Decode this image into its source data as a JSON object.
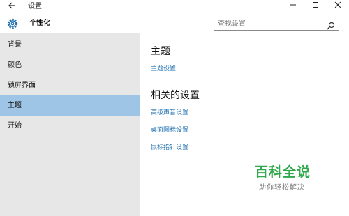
{
  "window": {
    "title": "设置",
    "back_icon": "arrow-left-icon"
  },
  "header": {
    "title": "个性化",
    "icon": "gear-icon"
  },
  "search": {
    "placeholder": "查找设置",
    "icon": "search-icon"
  },
  "sidebar": {
    "items": [
      {
        "label": "背景",
        "active": false
      },
      {
        "label": "颜色",
        "active": false
      },
      {
        "label": "锁屏界面",
        "active": false
      },
      {
        "label": "主题",
        "active": true
      },
      {
        "label": "开始",
        "active": false
      }
    ]
  },
  "main": {
    "heading": "主题",
    "theme_settings_link": "主题设置",
    "related_heading": "相关的设置",
    "related_links": [
      "高级声音设置",
      "桌面图标设置",
      "鼠标指针设置"
    ]
  },
  "watermark": {
    "title": "百科全说",
    "subtitle": "助你轻松解决"
  },
  "colors": {
    "accent": "#1e6fb0",
    "selection": "#9ec4e6",
    "sidebar_bg": "#e7e7e7",
    "watermark_green": "#2da84a"
  }
}
